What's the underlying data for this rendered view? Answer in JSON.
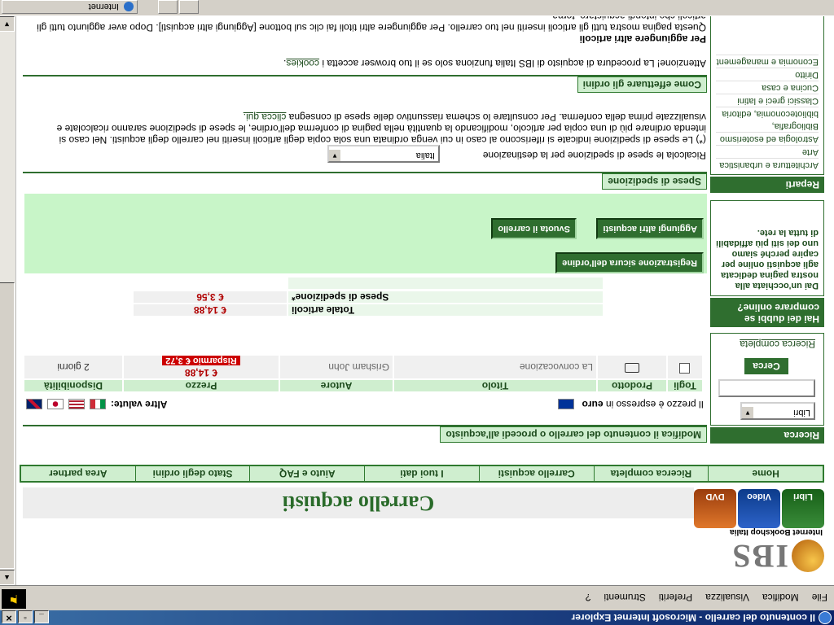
{
  "window": {
    "title": "Il contenuto del carrello - Microsoft Internet Explorer",
    "menu": [
      "File",
      "Modifica",
      "Visualizza",
      "Preferiti",
      "Strumenti",
      "?"
    ],
    "status_zone": "Internet"
  },
  "logo": {
    "name": "IBS",
    "tagline": "Internet Bookshop Italia"
  },
  "sections": [
    "Libri",
    "Video",
    "DVD"
  ],
  "page_title": "Carrello acquisti",
  "nav": [
    "Home",
    "Ricerca completa",
    "Carrello acquisti",
    "I tuoi dati",
    "Aiuto e FAQ",
    "Stato degli ordini",
    "Area partner"
  ],
  "sidebar": {
    "search": {
      "heading": "Ricerca",
      "category": "Libri",
      "button": "Cerca",
      "advanced_link": "Ricerca completa"
    },
    "doubts": {
      "heading": "Hai dei dubbi se comprare online?",
      "text": "Dai un'occhiata alla nostra pagina dedicata agli acquisti online per capire perché siamo uno dei siti più affidabili di tutta la rete."
    },
    "departments": {
      "heading": "Reparti",
      "items": [
        "Architettura e urbanistica",
        "Arte",
        "Astrologia ed esoterismo",
        "Bibliografia, biblioteconomia, editoria",
        "Classici greci e latini",
        "Cucina e casa",
        "Diritto",
        "Economia e management"
      ]
    }
  },
  "cart": {
    "heading": "Modifica il contenuto del carrello o procedi all'acquisto",
    "currency_note_prefix": "Il prezzo è espresso in",
    "currency_name": "euro",
    "other_currencies_label": "Altre valute:",
    "columns": [
      "Togli",
      "Prodotto",
      "Titolo",
      "Autore",
      "Prezzo",
      "Disponibilità"
    ],
    "rows": [
      {
        "title": "La convocazione",
        "author": "Grisham John",
        "price": "€ 14,88",
        "saving": "Risparmio € 3,72",
        "availability": "2 giorni"
      }
    ],
    "total_label": "Totale articoli",
    "total_value": "€ 14,88",
    "shipping_label": "Spese di spedizione*",
    "shipping_value": "€ 3,56",
    "buttons": {
      "add_more": "Aggiungi altri acquisti",
      "empty": "Svuota il carrello",
      "secure_checkout": "Registrazione sicura dell'ordine"
    }
  },
  "shipping": {
    "heading": "Spese di spedizione",
    "recalc_label": "Ricalcola le spese di spedizione per la destinazione",
    "destination": "Italia",
    "note_before_link": "(*) Le spese di spedizione indicate si riferiscono al caso in cui venga ordinata una sola copia degli articoli inseriti nel carrello degli acquisti. Nel caso si intenda ordinare più di una copia per articolo, modificando la quantità nella pagina di conferma dell'ordine, le spese di spedizione saranno ricalcolate e visualizzate prima della conferma. Per consultare lo schema riassuntivo delle spese di consegna",
    "note_link": "clicca qui."
  },
  "howto": {
    "heading": "Come effettuare gli ordini",
    "text_before_link": "Attenzione! La procedura di acquisto di IBS Italia funziona solo se il tuo browser accetta i",
    "link": "cookies",
    "text_after_link": "."
  },
  "add_more": {
    "heading": "Per aggiungere altri articoli",
    "text": "Questa pagina mostra tutti gli articoli inseriti nel tuo carrello. Per aggiungere altri titoli fai clic sul bottone [Aggiungi altri acquisti]. Dopo aver aggiunto tutti gli articoli che intendi acquistare, torna"
  },
  "colors": {
    "accent_green": "#2f6e2f",
    "light_green": "#cfeecf",
    "price_red": "#b00000",
    "titlebar_blue": "#0a246a"
  }
}
